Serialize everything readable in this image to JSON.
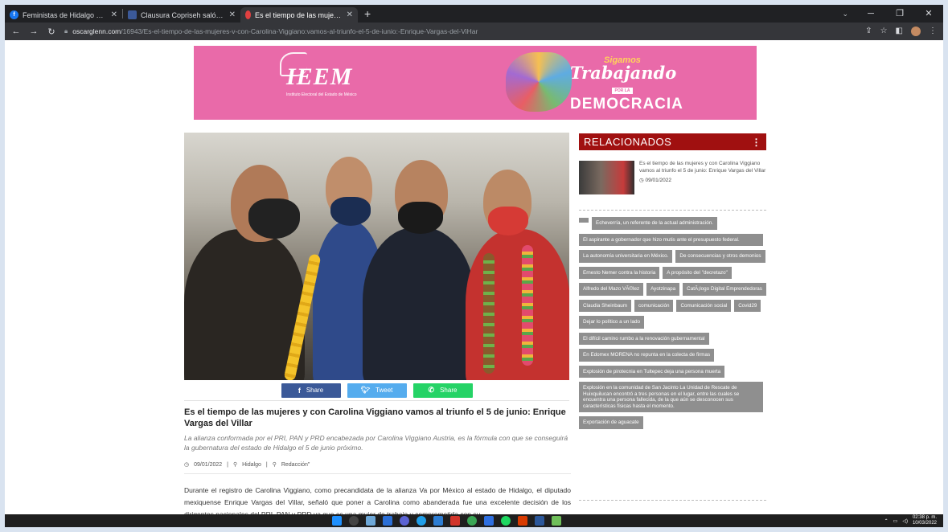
{
  "browser": {
    "tabs": [
      {
        "title": "Feministas de Hidalgo con Carol",
        "color": "#1877f2",
        "glyph": "f"
      },
      {
        "title": "Clausura Copriseh salón Benever",
        "color": "#3b5998",
        "glyph": ""
      },
      {
        "title": "Es el tiempo de las mujeres v con",
        "color": "#e04040",
        "glyph": ""
      }
    ],
    "new_tab": "+",
    "url_host": "oscarglenn.com",
    "url_path": "/16943/Es-el-tiempo-de-las-mujeres-v-con-Carolina-Viggiano:vamos-al-triunfo-el-5-de-iunio:-Enrique-Vargas-del-ViHar"
  },
  "banner": {
    "brand": "IEEM",
    "brand_sub": "Instituto Electoral del Estado de México",
    "slogan_top": "Sigamos",
    "slogan_mid": "Trabajando",
    "slogan_for": "POR LA",
    "slogan_bottom": "DEMOCRACIA"
  },
  "share": {
    "facebook": "Share",
    "twitter": "Tweet",
    "whatsapp": "Share"
  },
  "article": {
    "title": "Es el tiempo de las mujeres y con Carolina Viggiano vamos al triunfo el 5 de junio: Enrique Vargas del Villar",
    "lead": "La alianza conformada por el PRI, PAN y PRD encabezada por Carolina Viggiano Austria, es la fórmula con que se conseguirá la gubernatura del estado de Hidalgo el 5 de junio próximo.",
    "date": "09/01/2022",
    "section": "Hidalgo",
    "author": "Redacción\"",
    "body": "Durante el registro de Carolina Viggiano, como precandidata de la alianza Va por México al estado de Hidalgo, el diputado mexiquense Enrique Vargas del Villar, señaló que poner a Carolina como abanderada fue una excelente decisión de los dirigentes nacionales del PRI, PAN y PRD ya que es una mujer de trabajo y comprometida con su"
  },
  "sidebar": {
    "heading": "RELACIONADOS",
    "related": {
      "title": "Es el tiempo de las mujeres y con Carolina Viggiano vamos al triunfo el 5 de junio: Enrique Vargas del Villar",
      "date": "09/01/2022"
    },
    "tags": [
      "Echeverría, un referente de la actual administración.",
      "El aspirante a gobernador que hizo mutis ante el presupuesto federal.",
      "La autonomía universitaria en México.",
      "De consecuencias y otros demonios",
      "Ernesto Nemer contra la historia",
      "A propósito del \"decretazo\"",
      "Alfredo del Mazo VÃ©lez",
      "Ayotzinapa",
      "CatÃ¡logo Digital Emprendedoras",
      "Claudia Sheinbaum",
      "comunicación",
      "Comunicación social",
      "Covid29",
      "Dejar lo político a un lado",
      "El difícil camino rumbo a la renovación gubernamental",
      "En Edomex MORENA no repunta en la colecta de firmas",
      "Explosión de pirotecnia en Tultepec deja una persona muerta",
      "Explosión en la comunidad de San Jacinto La Unidad de Rescate de Huixquilucan encontró a tres personas en el lugar, entre las cuales se encuentra una persona fallecida, de la que aún se desconocen sus características físicas hasta el momento.",
      "Exportación de aguacate"
    ]
  },
  "taskbar": {
    "time": "02:38 p. m.",
    "date": "10/03/2022"
  }
}
